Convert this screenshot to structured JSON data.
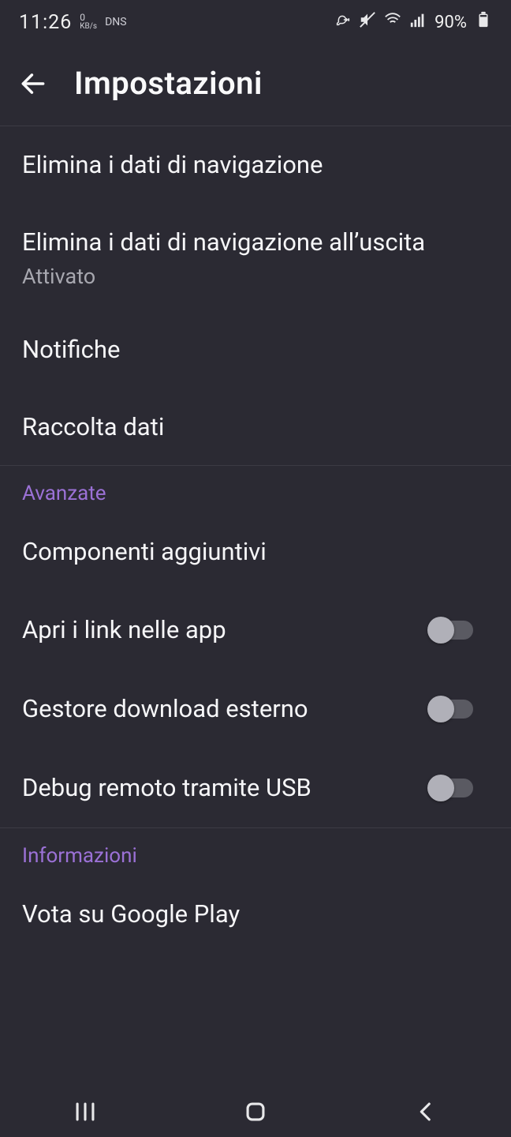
{
  "status": {
    "time": "11:26",
    "net_speed_top": "0",
    "net_speed_unit": "KB/s",
    "dns": "DNS",
    "battery_pct": "90%"
  },
  "header": {
    "title": "Impostazioni"
  },
  "items": {
    "clear_data": "Elimina i dati di navigazione",
    "clear_on_exit": "Elimina i dati di navigazione all’uscita",
    "clear_on_exit_sub": "Attivato",
    "notifications": "Notifiche",
    "data_collection": "Raccolta dati",
    "addons": "Componenti aggiuntivi",
    "open_links": "Apri i link nelle app",
    "ext_download": "Gestore download esterno",
    "usb_debug": "Debug remoto tramite USB",
    "rate_play": "Vota su Google Play"
  },
  "sections": {
    "advanced": "Avanzate",
    "info": "Informazioni"
  }
}
